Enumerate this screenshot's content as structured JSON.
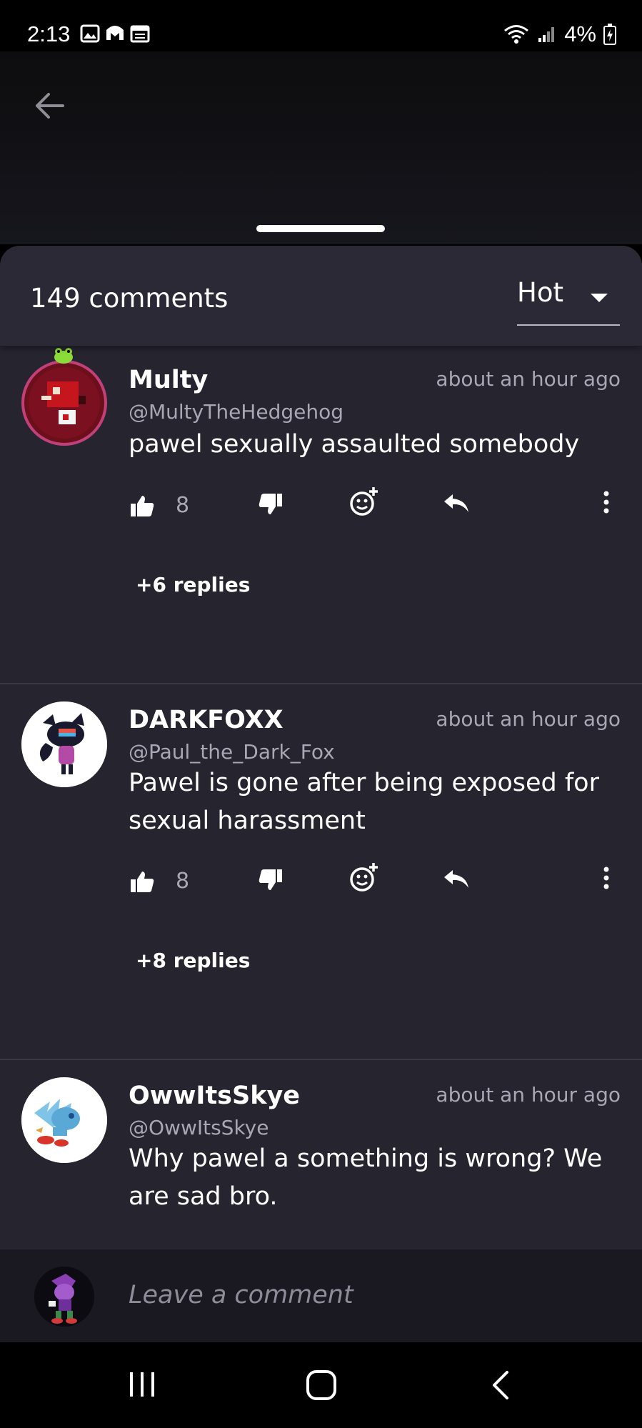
{
  "status_bar": {
    "time": "2:13",
    "battery": "4%",
    "left_icons": [
      "gallery-icon",
      "malwarebytes-icon",
      "calendar-icon"
    ],
    "right_icons": [
      "wifi-icon",
      "signal-icon",
      "battery-charging-icon"
    ]
  },
  "sheet": {
    "comment_count": "149 comments",
    "sort": {
      "selected": "Hot"
    }
  },
  "comments": [
    {
      "name": "Multy",
      "handle": "@MultyTheHedgehog",
      "time": "about an hour ago",
      "text": "pawel sexually assaulted somebody",
      "likes": "8",
      "replies": "+6 replies"
    },
    {
      "name": "DARKFOXX",
      "handle": "@Paul_the_Dark_Fox",
      "time": "about an hour ago",
      "text": "Pawel is gone after being exposed for sexual harassment",
      "likes": "8",
      "replies": "+8 replies"
    },
    {
      "name": "OwwItsSkye",
      "handle": "@OwwItsSkye",
      "time": "about an hour ago",
      "text": "Why pawel a something is wrong? We are sad bro."
    }
  ],
  "composer": {
    "placeholder": "Leave a comment"
  },
  "colors": {
    "sheet_bg": "#26242f",
    "header_bg": "#2b2935",
    "muted_text": "#a9a7b4",
    "divider": "#3a3845"
  }
}
